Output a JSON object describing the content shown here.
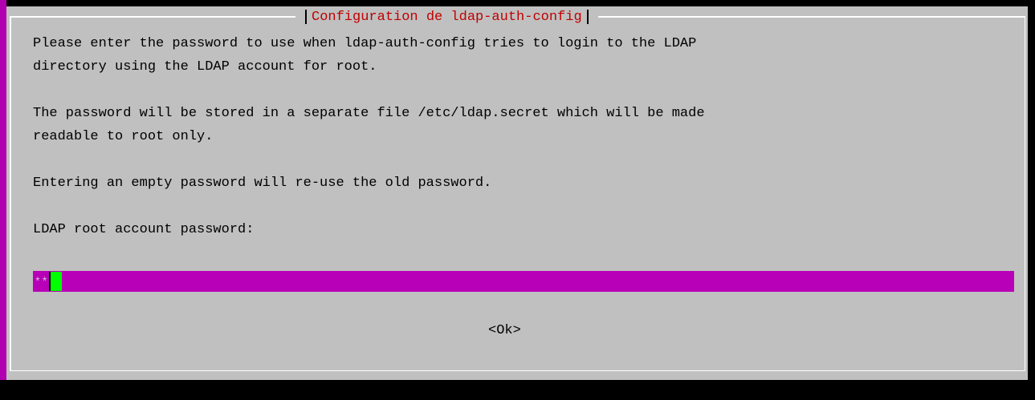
{
  "dialog": {
    "title": "Configuration de ldap-auth-config",
    "paragraph1_line1": "Please enter the password to use when ldap-auth-config tries to login to the LDAP",
    "paragraph1_line2": "directory using the LDAP account for root.",
    "paragraph2_line1": "The password will be stored in a separate file /etc/ldap.secret which will be made",
    "paragraph2_line2": "readable to root only.",
    "paragraph3": "Entering an empty password will re-use the old password.",
    "field_label": "LDAP root account password:",
    "password_value": "**",
    "ok_label": "<Ok>"
  },
  "colors": {
    "dialog_bg": "#c0c0c0",
    "title": "#c00000",
    "field_bg": "#b800b8",
    "cursor": "#00ff00",
    "terminal_bg": "#000000",
    "left_strip": "#b000b0"
  }
}
